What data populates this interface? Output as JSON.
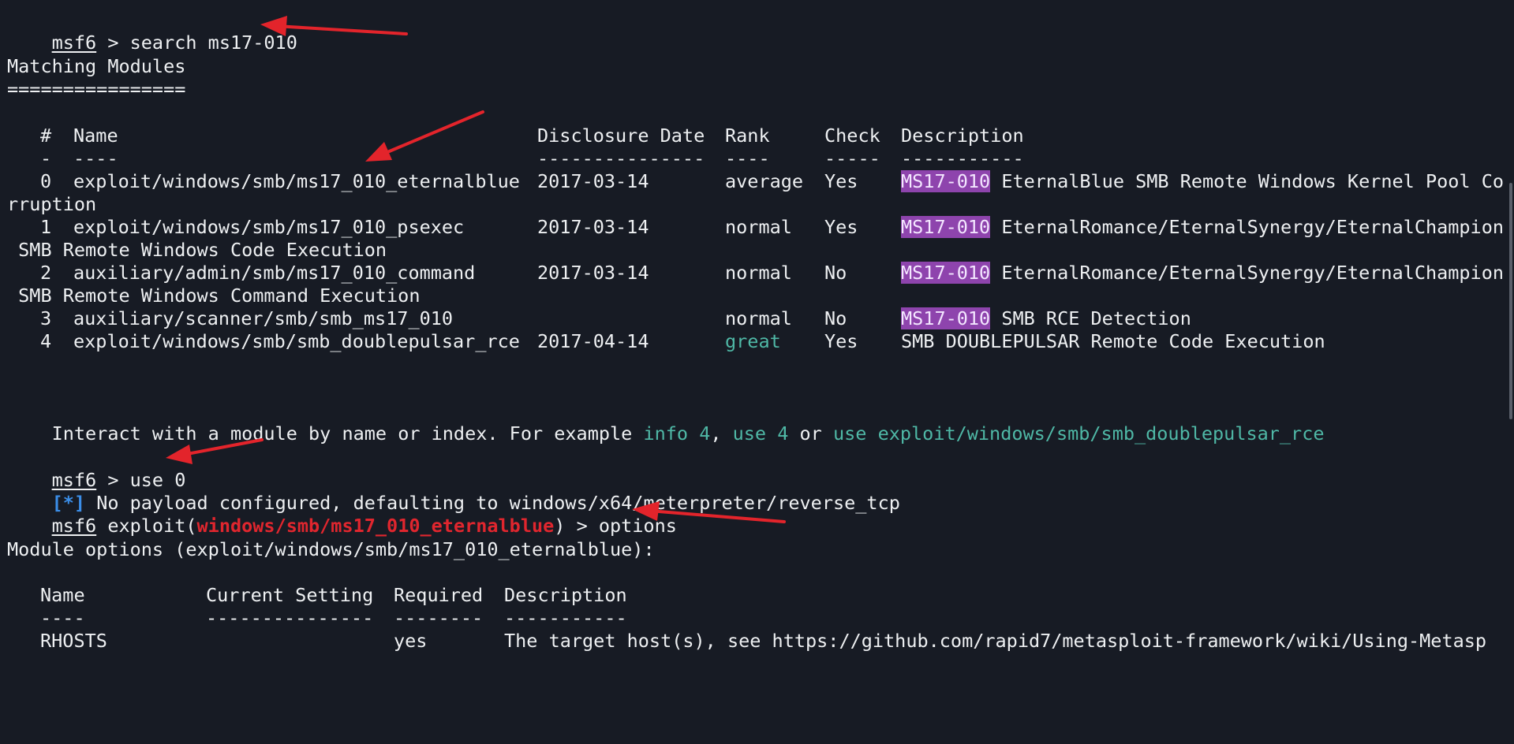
{
  "terminal": {
    "prompt": "msf6",
    "cmd_search": " > search ms17-010",
    "matching_title": "Matching Modules",
    "matching_underline": "================",
    "headers": {
      "num": "#",
      "name": "Name",
      "date": "Disclosure Date",
      "rank": "Rank",
      "check": "Check",
      "desc": "Description"
    },
    "header_rules": {
      "num": "-",
      "name": "----",
      "date": "---------------",
      "rank": "----",
      "check": "-----",
      "desc": "-----------"
    },
    "modules": [
      {
        "num": "0",
        "name": "exploit/windows/smb/ms17_010_eternalblue",
        "date": "2017-03-14",
        "rank": "average",
        "check": "Yes",
        "tag": "MS17-010",
        "desc": " EternalBlue SMB Remote Windows Kernel Pool Co",
        "wrap": "rruption"
      },
      {
        "num": "1",
        "name": "exploit/windows/smb/ms17_010_psexec",
        "date": "2017-03-14",
        "rank": "normal",
        "check": "Yes",
        "tag": "MS17-010",
        "desc": " EternalRomance/EternalSynergy/EternalChampion",
        "wrap": " SMB Remote Windows Code Execution"
      },
      {
        "num": "2",
        "name": "auxiliary/admin/smb/ms17_010_command",
        "date": "2017-03-14",
        "rank": "normal",
        "check": "No",
        "tag": "MS17-010",
        "desc": " EternalRomance/EternalSynergy/EternalChampion",
        "wrap": " SMB Remote Windows Command Execution"
      },
      {
        "num": "3",
        "name": "auxiliary/scanner/smb/smb_ms17_010",
        "date": "",
        "rank": "normal",
        "check": "No",
        "tag": "MS17-010",
        "desc": " SMB RCE Detection",
        "wrap": ""
      },
      {
        "num": "4",
        "name": "exploit/windows/smb/smb_doublepulsar_rce",
        "date": "2017-04-14",
        "rank": "great",
        "check": "Yes",
        "tag": "",
        "desc": "SMB DOUBLEPULSAR Remote Code Execution",
        "wrap": ""
      }
    ],
    "interact": {
      "prefix": "Interact with a module by name or index. For example ",
      "link1": "info 4",
      "sep1": ", ",
      "link2": "use 4",
      "sep2": " or ",
      "link3": "use exploit/windows/smb/smb_doublepulsar_rce"
    },
    "cmd_use": " > use 0",
    "info_tag": "[*]",
    "info_text": " No payload configured, defaulting to windows/x64/meterpreter/reverse_tcp",
    "exploit_prefix": " exploit(",
    "exploit_module": "windows/smb/ms17_010_eternalblue",
    "exploit_suffix": ") > options",
    "module_options": "Module options (exploit/windows/smb/ms17_010_eternalblue):",
    "opt_headers": {
      "name": "Name",
      "setting": "Current Setting",
      "required": "Required",
      "desc": "Description"
    },
    "opt_rules": {
      "name": "----",
      "setting": "---------------",
      "required": "--------",
      "desc": "-----------"
    },
    "opt_row": {
      "name": "RHOSTS",
      "setting": "",
      "required": "yes",
      "desc": "The target host(s), see https://github.com/rapid7/metasploit-framework/wiki/Using-Metasp"
    }
  },
  "colors": {
    "background": "#171b24",
    "text": "#eef0f2",
    "highlight": "#8e44ad",
    "teal": "#4fb8a6",
    "info_blue": "#3b8ee8",
    "module_red": "#e0262e",
    "arrow_red": "#e3242b"
  },
  "icons": [
    "red-arrow-icon"
  ]
}
